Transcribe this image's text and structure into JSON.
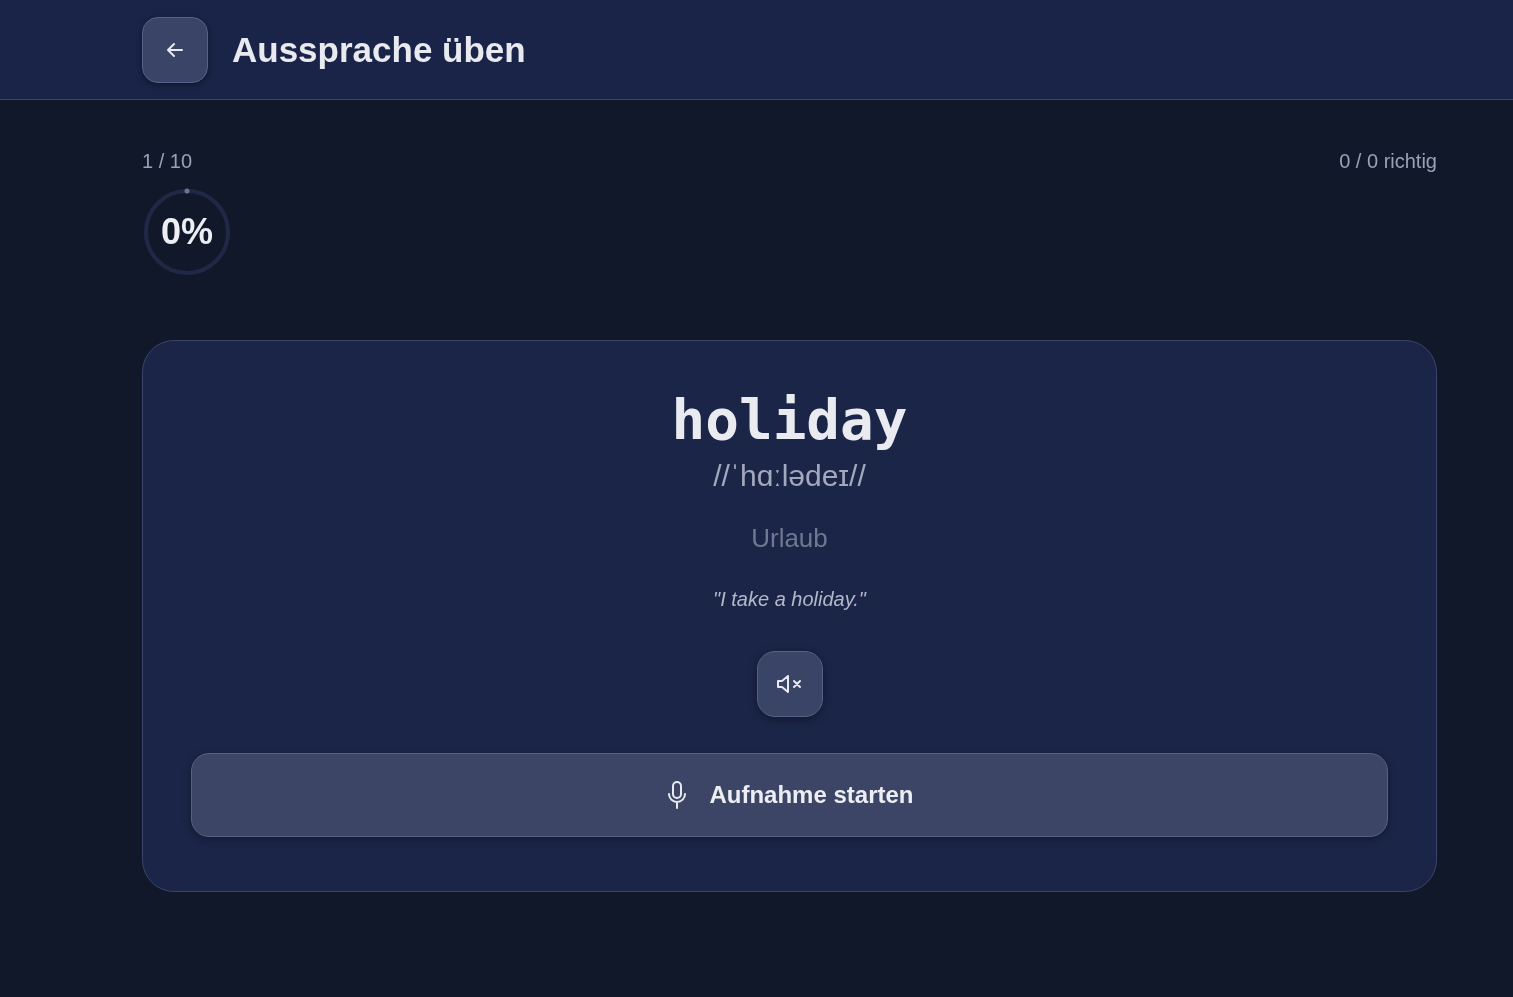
{
  "header": {
    "title": "Aussprache üben"
  },
  "progress": {
    "counter": "1 / 10",
    "percent": "0%",
    "level": 0,
    "score": "0 / 0 richtig"
  },
  "card": {
    "word": "holiday",
    "phonetic": "//ˈhɑːlədeɪ//",
    "translation": "Urlaub",
    "example": "\"I take a holiday.\"",
    "muted": true,
    "record_label": "Aufnahme starten"
  }
}
